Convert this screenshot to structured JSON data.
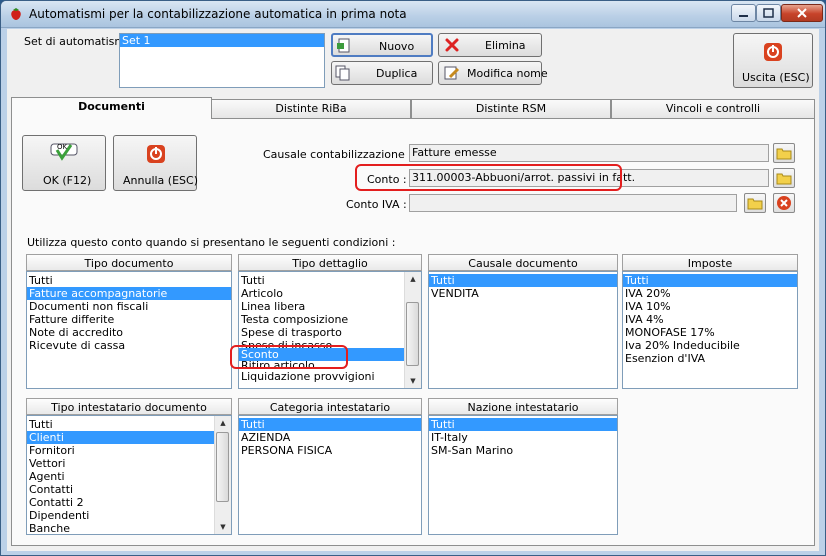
{
  "window": {
    "title": "Automatismi per la contabilizzazione automatica in prima nota"
  },
  "top": {
    "set_label": "Set di automatismi :",
    "sets": [
      "Set 1"
    ],
    "nuovo": "Nuovo",
    "duplica": "Duplica",
    "elimina": "Elimina",
    "modifica_nome": "Modifica nome",
    "uscita": "Uscita (ESC)"
  },
  "tabs": [
    "Documenti",
    "Distinte RiBa",
    "Distinte RSM",
    "Vincoli e controlli"
  ],
  "doc": {
    "ok": "OK (F12)",
    "ok_icon_text": "OK",
    "annulla": "Annulla (ESC)",
    "causale_label": "Causale contabilizzazione :",
    "causale_value": "Fatture emesse",
    "conto_label": "Conto :",
    "conto_value": "311.00003-Abbuoni/arrot. passivi in fatt.",
    "conto_iva_label": "Conto IVA :",
    "conto_iva_value": "",
    "conditions_label": "Utilizza questo conto quando si presentano le seguenti condizioni :"
  },
  "lists": {
    "tipo_documento": {
      "header": "Tipo documento",
      "items": [
        "Tutti",
        "Fatture accompagnatorie",
        "Documenti non fiscali",
        "Fatture differite",
        "Note di accredito",
        "Ricevute di cassa"
      ],
      "selected": 1
    },
    "tipo_dettaglio": {
      "header": "Tipo dettaglio",
      "items": [
        "Tutti",
        "Articolo",
        "Linea libera",
        "Testa composizione",
        "Spese di trasporto",
        "Spese di incasso",
        "Sconto",
        "Ritiro articolo",
        "Liquidazione provvigioni"
      ],
      "selected": 6
    },
    "causale_documento": {
      "header": "Causale documento",
      "items": [
        "Tutti",
        "VENDITA"
      ],
      "selected": 0
    },
    "imposte": {
      "header": "Imposte",
      "items": [
        "Tutti",
        "IVA 20%",
        "IVA 10%",
        "IVA 4%",
        "MONOFASE 17%",
        "Iva 20% Indeducibile",
        "Esenzion d'IVA"
      ],
      "selected": 0
    },
    "tipo_intestatario": {
      "header": "Tipo intestatario documento",
      "items": [
        "Tutti",
        "Clienti",
        "Fornitori",
        "Vettori",
        "Agenti",
        "Contatti",
        "Contatti 2",
        "Dipendenti",
        "Banche"
      ],
      "selected": 1
    },
    "categoria_intestatario": {
      "header": "Categoria intestatario",
      "items": [
        "Tutti",
        "AZIENDA",
        "PERSONA FISICA"
      ],
      "selected": 0
    },
    "nazione_intestatario": {
      "header": "Nazione intestatario",
      "items": [
        "Tutti",
        "IT-Italy",
        "SM-San Marino"
      ],
      "selected": 0
    }
  },
  "colors": {
    "selection": "#3399ff",
    "highlight_ring": "#e31e1e"
  }
}
